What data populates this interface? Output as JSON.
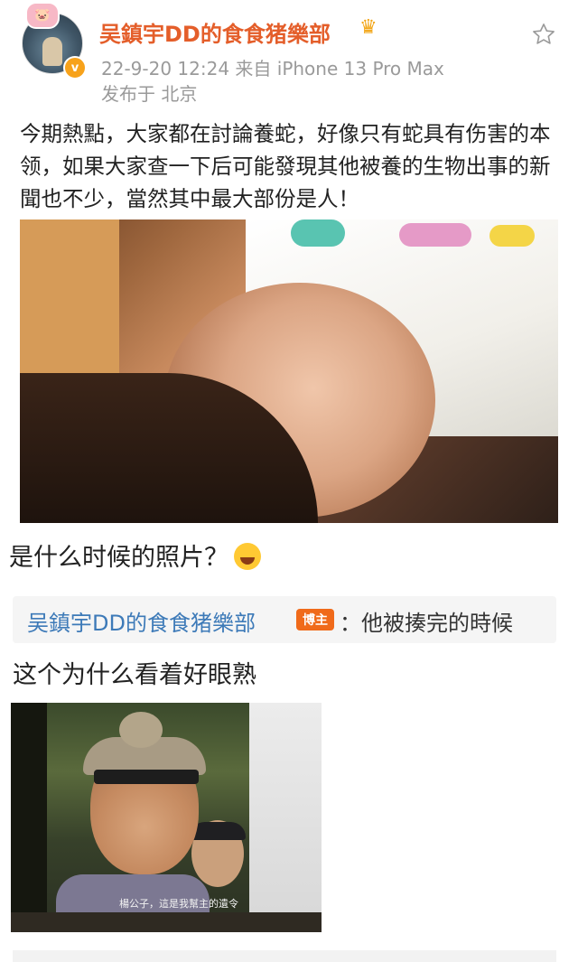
{
  "post": {
    "username": "吴鎮宇DD的食食猪樂部",
    "meta": "22-9-20 12:24  来自 iPhone 13 Pro Max",
    "location": "发布于 北京",
    "text": "今期熱點，大家都在討論養蛇，好像只有蛇具有伤害的本领，如果大家查一下后可能發現其他被養的生物出事的新聞也不少，當然其中最大部份是人！"
  },
  "comments": [
    {
      "text": "是什么时候的照片？"
    },
    {
      "text": "这个为什么看着好眼熟"
    }
  ],
  "reply": {
    "name": "吴鎮宇DD的食食猪樂部",
    "badge": "博主",
    "separator": "：",
    "text": "他被揍完的時候"
  },
  "photo2": {
    "subtitle": "楊公子，這是我幫主的遺令"
  },
  "icons": {
    "avatar": "avatar-image",
    "verified": "verified-badge-icon",
    "crown": "crown-icon",
    "favorite": "star-icon",
    "emoji": "laughing-tears-emoji"
  },
  "colors": {
    "username": "#e45e2a",
    "reply_name": "#3d7ab8",
    "badge": "#f06a1a",
    "meta": "#9a9a9a"
  }
}
